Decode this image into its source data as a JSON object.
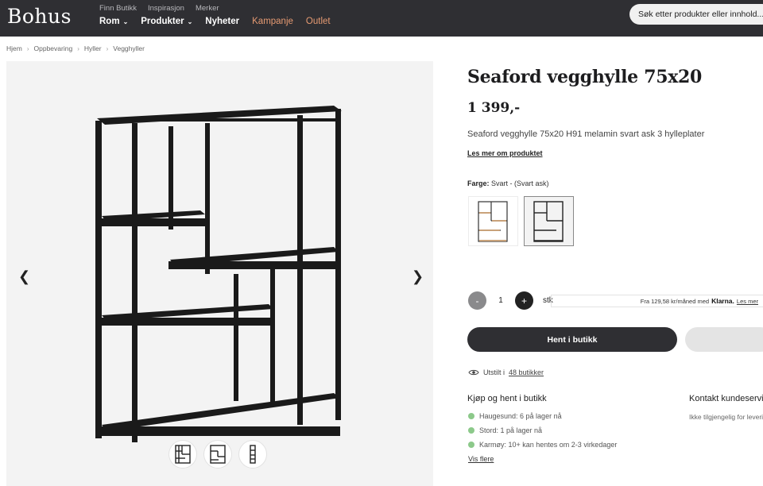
{
  "header": {
    "logo": "Bohus",
    "top_links": [
      "Finn Butikk",
      "Inspirasjon",
      "Merker"
    ],
    "nav": [
      {
        "label": "Rom",
        "dropdown": true
      },
      {
        "label": "Produkter",
        "dropdown": true
      },
      {
        "label": "Nyheter",
        "dropdown": false
      },
      {
        "label": "Kampanje",
        "dropdown": false,
        "accent": true
      },
      {
        "label": "Outlet",
        "dropdown": false,
        "accent": true
      }
    ],
    "search_placeholder": "Søk etter produkter eller innhold..."
  },
  "breadcrumb": [
    "Hjem",
    "Oppbevaring",
    "Hyller",
    "Vegghyller"
  ],
  "product": {
    "title": "Seaford vegghylle 75x20",
    "price": "1 399,-",
    "description": "Seaford vegghylle 75x20 H91 melamin svart ask 3 hylleplater",
    "read_more": "Les mer om produktet",
    "color_label": "Farge:",
    "color_value": "Svart - (Svart ask)"
  },
  "quantity": {
    "minus": "-",
    "value": "1",
    "plus": "+",
    "unit": "stk"
  },
  "klarna": {
    "text": "Fra 129,58 kr/måned med",
    "brand": "Klarna.",
    "link": "Les mer"
  },
  "buttons": {
    "store": "Hent i butikk"
  },
  "exhibit": {
    "prefix": "Utstilt i",
    "link": "48 butikker"
  },
  "pickup": {
    "title": "Kjøp og hent i butikk",
    "stores": [
      "Haugesund: 6 på lager nå",
      "Stord: 1 på lager nå",
      "Karmøy: 10+ kan hentes om 2-3 virkedager"
    ],
    "more": "Vis flere"
  },
  "contact": {
    "title": "Kontakt kundeservice",
    "subtitle": "Ikke tilgjengelig for levering"
  },
  "colors": {
    "header_bg": "#2f2f33",
    "accent": "#e69a72",
    "stock_dot": "#8cc98a"
  }
}
